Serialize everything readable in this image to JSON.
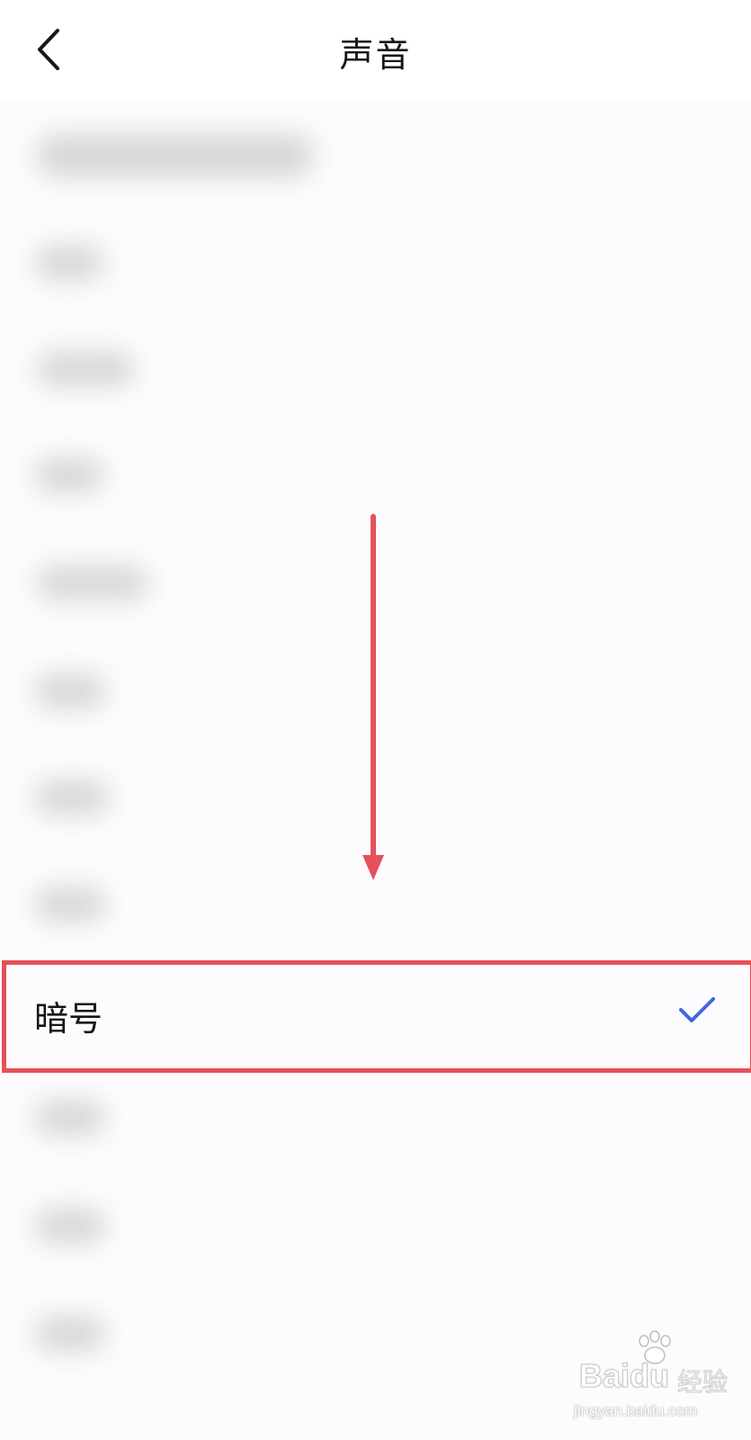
{
  "header": {
    "title": "声音",
    "back_icon": "chevron-left-icon"
  },
  "selected_item": {
    "label": "暗号",
    "check_icon": "checkmark-icon",
    "check_color": "#3f67e0"
  },
  "annotation": {
    "highlight_color": "#e5505a",
    "arrow_color": "#e5505a"
  },
  "watermark": {
    "logo": "Bai",
    "logo_suffix": "du",
    "chinese": "经验",
    "url": "jingyan.baidu.com"
  }
}
